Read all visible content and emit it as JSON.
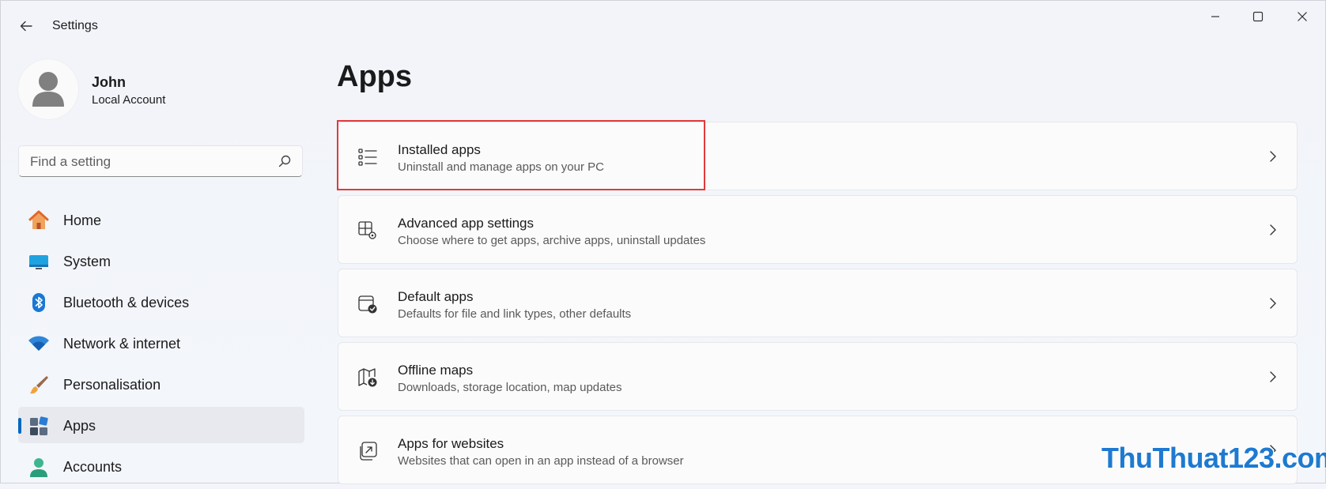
{
  "window": {
    "title": "Settings"
  },
  "profile": {
    "name": "John",
    "account_type": "Local Account"
  },
  "search": {
    "placeholder": "Find a setting"
  },
  "sidebar": {
    "items": [
      {
        "label": "Home",
        "icon": "home-icon"
      },
      {
        "label": "System",
        "icon": "system-icon"
      },
      {
        "label": "Bluetooth & devices",
        "icon": "bluetooth-icon"
      },
      {
        "label": "Network & internet",
        "icon": "wifi-icon"
      },
      {
        "label": "Personalisation",
        "icon": "brush-icon"
      },
      {
        "label": "Apps",
        "icon": "apps-icon",
        "active": true
      },
      {
        "label": "Accounts",
        "icon": "accounts-icon"
      }
    ]
  },
  "main": {
    "title": "Apps",
    "cards": [
      {
        "title": "Installed apps",
        "desc": "Uninstall and manage apps on your PC",
        "icon": "list-icon",
        "highlighted": true
      },
      {
        "title": "Advanced app settings",
        "desc": "Choose where to get apps, archive apps, uninstall updates",
        "icon": "app-settings-icon"
      },
      {
        "title": "Default apps",
        "desc": "Defaults for file and link types, other defaults",
        "icon": "default-apps-icon"
      },
      {
        "title": "Offline maps",
        "desc": "Downloads, storage location, map updates",
        "icon": "offline-map-icon"
      },
      {
        "title": "Apps for websites",
        "desc": "Websites that can open in an app instead of a browser",
        "icon": "open-external-icon"
      }
    ]
  },
  "watermark": {
    "text": "ThuThuat123.com"
  },
  "colors": {
    "accent": "#0067c0",
    "highlight_border": "#e23b3b",
    "watermark": "#1e7ad0"
  }
}
